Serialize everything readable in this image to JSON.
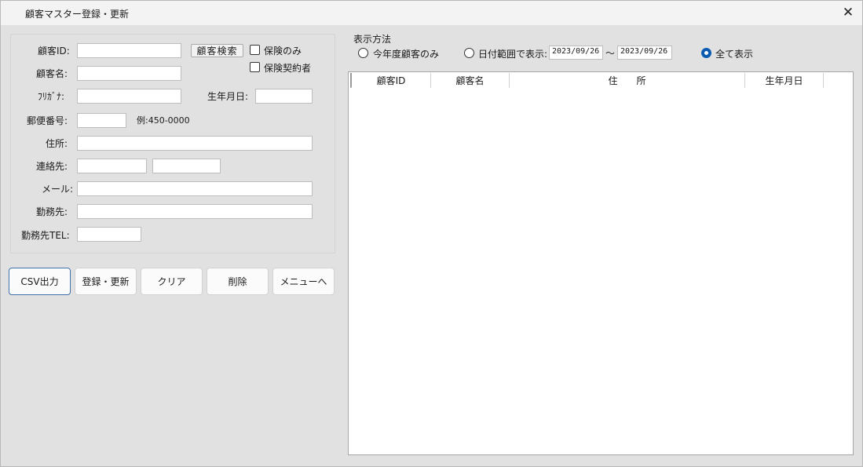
{
  "window": {
    "title": "顧客マスター登録・更新",
    "close_icon": "close-icon"
  },
  "form": {
    "customer_id_label": "顧客ID:",
    "customer_id_value": "",
    "search_button": "顧客検索",
    "insurance_only_label": "保険のみ",
    "insurance_only_checked": false,
    "insurance_contract_label": "保険契約者",
    "insurance_contract_checked": false,
    "customer_name_label": "顧客名:",
    "customer_name_value": "",
    "furigana_label": "ﾌﾘｶﾞﾅ:",
    "furigana_value": "",
    "birthdate_label": "生年月日:",
    "birthdate_value": "",
    "postal_label": "郵便番号:",
    "postal_value": "",
    "postal_example": "例:450-0000",
    "address_label": "住所:",
    "address_value": "",
    "contact_label": "連絡先:",
    "contact1_value": "",
    "contact2_value": "",
    "email_label": "メール:",
    "email_value": "",
    "workplace_label": "勤務先:",
    "workplace_value": "",
    "workplace_tel_label": "勤務先TEL:",
    "workplace_tel_value": ""
  },
  "actions": {
    "csv": "CSV出力",
    "register": "登録・更新",
    "clear": "クリア",
    "delete": "削除",
    "menu": "メニューへ"
  },
  "display": {
    "group_title": "表示方法",
    "option_current_year": "今年度顧客のみ",
    "option_date_range": "日付範囲で表示:",
    "date_from": "2023/09/26",
    "tilde": "～",
    "date_to": "2023/09/26",
    "option_all": "全て表示",
    "selected": "all"
  },
  "table": {
    "columns": [
      "顧客ID",
      "顧客名",
      "住　　所",
      "生年月日"
    ],
    "rows": []
  }
}
